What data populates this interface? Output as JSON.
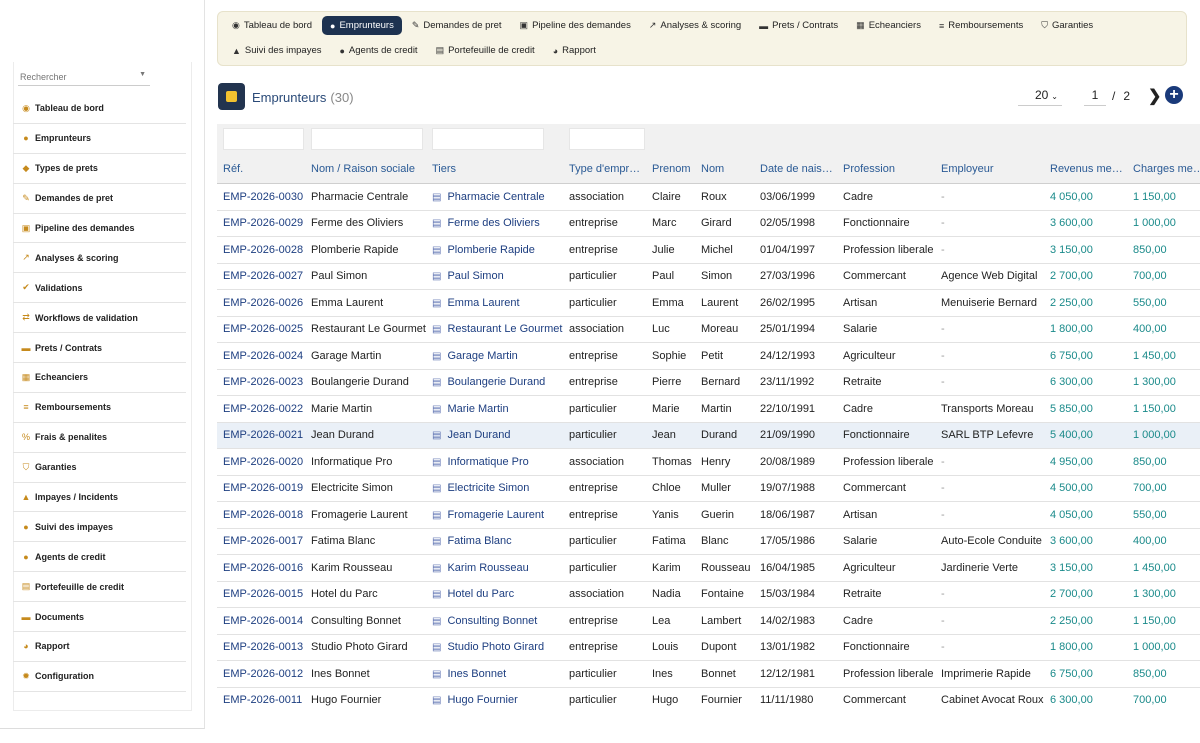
{
  "sidebar": {
    "search_placeholder": "Rechercher",
    "items": [
      {
        "label": "Tableau de bord",
        "icon": "dashboard-icon",
        "glyph": "◉"
      },
      {
        "label": "Emprunteurs",
        "icon": "user-icon",
        "glyph": "●"
      },
      {
        "label": "Types de prets",
        "icon": "tag-icon",
        "glyph": "◆"
      },
      {
        "label": "Demandes de pret",
        "icon": "edit-icon",
        "glyph": "✎"
      },
      {
        "label": "Pipeline des demandes",
        "icon": "pipeline-icon",
        "glyph": "▣"
      },
      {
        "label": "Analyses & scoring",
        "icon": "chart-icon",
        "glyph": "↗"
      },
      {
        "label": "Validations",
        "icon": "check-icon",
        "glyph": "✔"
      },
      {
        "label": "Workflows de validation",
        "icon": "workflow-icon",
        "glyph": "⇄"
      },
      {
        "label": "Prets / Contrats",
        "icon": "contract-icon",
        "glyph": "▬"
      },
      {
        "label": "Echeanciers",
        "icon": "calendar-icon",
        "glyph": "▦"
      },
      {
        "label": "Remboursements",
        "icon": "payment-icon",
        "glyph": "≡"
      },
      {
        "label": "Frais & penalites",
        "icon": "percent-icon",
        "glyph": "%"
      },
      {
        "label": "Garanties",
        "icon": "shield-icon",
        "glyph": "⛉"
      },
      {
        "label": "Impayes / Incidents",
        "icon": "warning-icon",
        "glyph": "▲"
      },
      {
        "label": "Suivi des impayes",
        "icon": "alert-circle-icon",
        "glyph": "●"
      },
      {
        "label": "Agents de credit",
        "icon": "agent-icon",
        "glyph": "●"
      },
      {
        "label": "Portefeuille de credit",
        "icon": "portfolio-icon",
        "glyph": "▤"
      },
      {
        "label": "Documents",
        "icon": "folder-icon",
        "glyph": "▬"
      },
      {
        "label": "Rapport",
        "icon": "report-icon",
        "glyph": "◕"
      },
      {
        "label": "Configuration",
        "icon": "gear-icon",
        "glyph": "✹"
      }
    ]
  },
  "topnav": {
    "row1": [
      {
        "label": "Tableau de bord",
        "icon": "dashboard-icon",
        "glyph": "◉",
        "active": false
      },
      {
        "label": "Emprunteurs",
        "icon": "user-icon",
        "glyph": "●",
        "active": true
      },
      {
        "label": "Demandes de pret",
        "icon": "edit-icon",
        "glyph": "✎",
        "active": false
      },
      {
        "label": "Pipeline des demandes",
        "icon": "pipeline-icon",
        "glyph": "▣",
        "active": false
      },
      {
        "label": "Analyses & scoring",
        "icon": "chart-icon",
        "glyph": "↗",
        "active": false
      },
      {
        "label": "Prets / Contrats",
        "icon": "contract-icon",
        "glyph": "▬",
        "active": false
      },
      {
        "label": "Echeanciers",
        "icon": "calendar-icon",
        "glyph": "▦",
        "active": false
      },
      {
        "label": "Remboursements",
        "icon": "payment-icon",
        "glyph": "≡",
        "active": false
      },
      {
        "label": "Garanties",
        "icon": "shield-icon",
        "glyph": "⛉",
        "active": false
      }
    ],
    "row2": [
      {
        "label": "Suivi des impayes",
        "icon": "warning-icon",
        "glyph": "▲",
        "active": false
      },
      {
        "label": "Agents de credit",
        "icon": "agent-icon",
        "glyph": "●",
        "active": false
      },
      {
        "label": "Portefeuille de credit",
        "icon": "portfolio-icon",
        "glyph": "▤",
        "active": false
      },
      {
        "label": "Rapport",
        "icon": "report-icon",
        "glyph": "◕",
        "active": false
      }
    ]
  },
  "page": {
    "title": "Emprunteurs",
    "count": "(30)",
    "per_page": "20",
    "current_page": "1",
    "separator": "/",
    "total_pages": "2",
    "next_glyph": "❯",
    "add_glyph": "+"
  },
  "table": {
    "columns": [
      "Réf.",
      "Nom / Raison sociale",
      "Tiers",
      "Type d'empr…",
      "Prenom",
      "Nom",
      "Date de nais…",
      "Profession",
      "Employeur",
      "Revenus me…",
      "Charges me…"
    ],
    "rows": [
      [
        "EMP-2026-0030",
        "Pharmacie Centrale",
        "Pharmacie Centrale",
        "association",
        "Claire",
        "Roux",
        "03/06/1999",
        "Cadre",
        "-",
        "4 050,00",
        "1 150,00"
      ],
      [
        "EMP-2026-0029",
        "Ferme des Oliviers",
        "Ferme des Oliviers",
        "entreprise",
        "Marc",
        "Girard",
        "02/05/1998",
        "Fonctionnaire",
        "-",
        "3 600,00",
        "1 000,00"
      ],
      [
        "EMP-2026-0028",
        "Plomberie Rapide",
        "Plomberie Rapide",
        "entreprise",
        "Julie",
        "Michel",
        "01/04/1997",
        "Profession liberale",
        "-",
        "3 150,00",
        "850,00"
      ],
      [
        "EMP-2026-0027",
        "Paul Simon",
        "Paul Simon",
        "particulier",
        "Paul",
        "Simon",
        "27/03/1996",
        "Commercant",
        "Agence Web Digital",
        "2 700,00",
        "700,00"
      ],
      [
        "EMP-2026-0026",
        "Emma Laurent",
        "Emma Laurent",
        "particulier",
        "Emma",
        "Laurent",
        "26/02/1995",
        "Artisan",
        "Menuiserie Bernard",
        "2 250,00",
        "550,00"
      ],
      [
        "EMP-2026-0025",
        "Restaurant Le Gourmet",
        "Restaurant Le Gourmet",
        "association",
        "Luc",
        "Moreau",
        "25/01/1994",
        "Salarie",
        "-",
        "1 800,00",
        "400,00"
      ],
      [
        "EMP-2026-0024",
        "Garage Martin",
        "Garage Martin",
        "entreprise",
        "Sophie",
        "Petit",
        "24/12/1993",
        "Agriculteur",
        "-",
        "6 750,00",
        "1 450,00"
      ],
      [
        "EMP-2026-0023",
        "Boulangerie Durand",
        "Boulangerie Durand",
        "entreprise",
        "Pierre",
        "Bernard",
        "23/11/1992",
        "Retraite",
        "-",
        "6 300,00",
        "1 300,00"
      ],
      [
        "EMP-2026-0022",
        "Marie Martin",
        "Marie Martin",
        "particulier",
        "Marie",
        "Martin",
        "22/10/1991",
        "Cadre",
        "Transports Moreau",
        "5 850,00",
        "1 150,00"
      ],
      [
        "EMP-2026-0021",
        "Jean Durand",
        "Jean Durand",
        "particulier",
        "Jean",
        "Durand",
        "21/09/1990",
        "Fonctionnaire",
        "SARL BTP Lefevre",
        "5 400,00",
        "1 000,00"
      ],
      [
        "EMP-2026-0020",
        "Informatique Pro",
        "Informatique Pro",
        "association",
        "Thomas",
        "Henry",
        "20/08/1989",
        "Profession liberale",
        "-",
        "4 950,00",
        "850,00"
      ],
      [
        "EMP-2026-0019",
        "Electricite Simon",
        "Electricite Simon",
        "entreprise",
        "Chloe",
        "Muller",
        "19/07/1988",
        "Commercant",
        "-",
        "4 500,00",
        "700,00"
      ],
      [
        "EMP-2026-0018",
        "Fromagerie Laurent",
        "Fromagerie Laurent",
        "entreprise",
        "Yanis",
        "Guerin",
        "18/06/1987",
        "Artisan",
        "-",
        "4 050,00",
        "550,00"
      ],
      [
        "EMP-2026-0017",
        "Fatima Blanc",
        "Fatima Blanc",
        "particulier",
        "Fatima",
        "Blanc",
        "17/05/1986",
        "Salarie",
        "Auto-Ecole Conduite",
        "3 600,00",
        "400,00"
      ],
      [
        "EMP-2026-0016",
        "Karim Rousseau",
        "Karim Rousseau",
        "particulier",
        "Karim",
        "Rousseau",
        "16/04/1985",
        "Agriculteur",
        "Jardinerie Verte",
        "3 150,00",
        "1 450,00"
      ],
      [
        "EMP-2026-0015",
        "Hotel du Parc",
        "Hotel du Parc",
        "association",
        "Nadia",
        "Fontaine",
        "15/03/1984",
        "Retraite",
        "-",
        "2 700,00",
        "1 300,00"
      ],
      [
        "EMP-2026-0014",
        "Consulting Bonnet",
        "Consulting Bonnet",
        "entreprise",
        "Lea",
        "Lambert",
        "14/02/1983",
        "Cadre",
        "-",
        "2 250,00",
        "1 150,00"
      ],
      [
        "EMP-2026-0013",
        "Studio Photo Girard",
        "Studio Photo Girard",
        "entreprise",
        "Louis",
        "Dupont",
        "13/01/1982",
        "Fonctionnaire",
        "-",
        "1 800,00",
        "1 000,00"
      ],
      [
        "EMP-2026-0012",
        "Ines Bonnet",
        "Ines Bonnet",
        "particulier",
        "Ines",
        "Bonnet",
        "12/12/1981",
        "Profession liberale",
        "Imprimerie Rapide",
        "6 750,00",
        "850,00"
      ],
      [
        "EMP-2026-0011",
        "Hugo Fournier",
        "Hugo Fournier",
        "particulier",
        "Hugo",
        "Fournier",
        "11/11/1980",
        "Commercant",
        "Cabinet Avocat Roux",
        "6 300,00",
        "700,00"
      ]
    ],
    "highlighted_row": 9,
    "tiers_glyph": "▤"
  }
}
